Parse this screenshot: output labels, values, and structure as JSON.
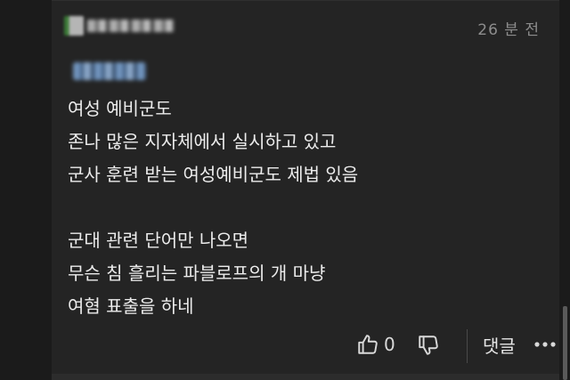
{
  "comment": {
    "time": "26 분 전",
    "body_lines": [
      "여성 예비군도",
      "존나 많은 지자체에서 실시하고 있고",
      "군사 훈련 받는 여성예비군도 제법 있음",
      "",
      "군대 관련 단어만 나오면",
      "무슨 침 흘리는 파블로프의 개 마냥",
      "여혐 표출을 하네"
    ],
    "like_count": "0",
    "reply_label": "댓글"
  },
  "icons": {
    "like": "thumbs-up-icon",
    "dislike": "thumbs-down-icon",
    "more": "more-dots-icon"
  },
  "colors": {
    "background": "#242424",
    "text": "#ececec",
    "muted": "#8d8d8d"
  }
}
